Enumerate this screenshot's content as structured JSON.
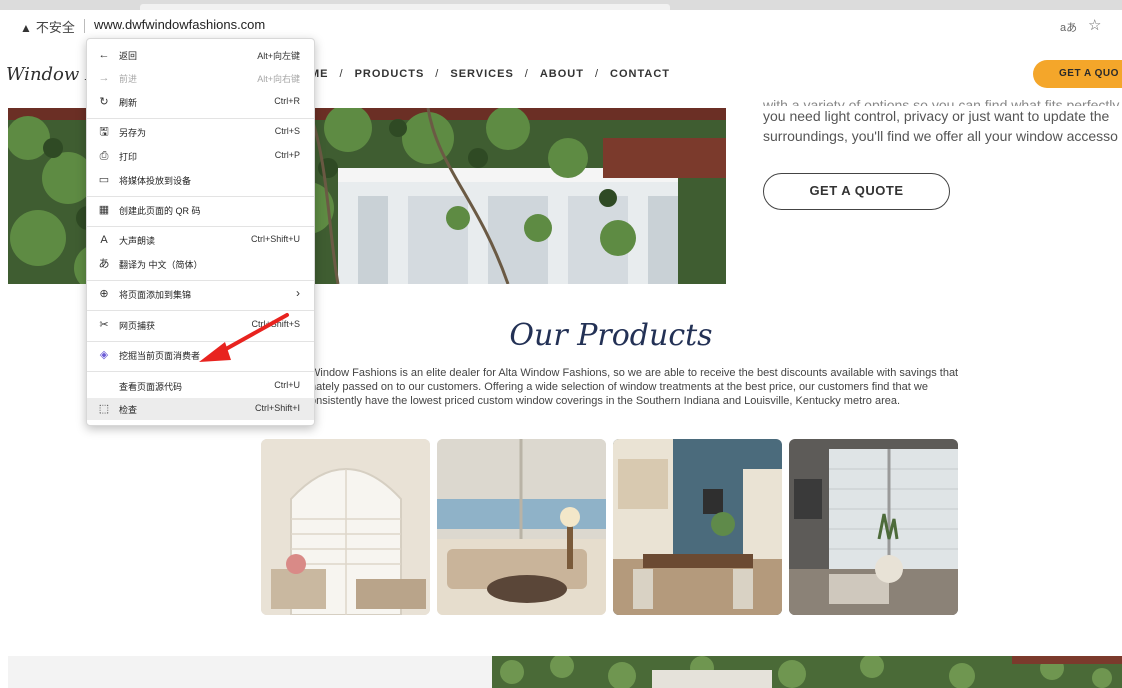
{
  "browser": {
    "security_label": "不安全",
    "url": "www.dwfwindowfashions.com",
    "translate_icon": "aあ",
    "favorites_icon": "star-plus"
  },
  "site": {
    "logo": "Window Fashions",
    "nav": [
      "ME",
      "PRODUCTS",
      "SERVICES",
      "ABOUT",
      "CONTACT"
    ],
    "nav_separator": "/",
    "header_cta": "GET A QUO",
    "hero": {
      "text_lines": [
        "with a variety of options so you can find what fits perfectly",
        "you need light control, privacy or just want to update the",
        "surroundings, you'll find we offer all your window accesso"
      ],
      "cta": "GET A QUOTE"
    },
    "products": {
      "title": "Our Products",
      "description": "Window Fashions is an elite dealer for Alta Window Fashions, so we are able to receive the best discounts available with savings that nately passed on to our customers. Offering a wide selection of window treatments at the best price, our customers find that we onsistently have the lowest priced custom window coverings in the Southern Indiana and Louisville, Kentucky metro area."
    }
  },
  "context_menu": {
    "items": [
      {
        "icon": "←",
        "label": "返回",
        "shortcut": "Alt+向左键",
        "disabled": false
      },
      {
        "icon": "→",
        "label": "前进",
        "shortcut": "Alt+向右键",
        "disabled": true
      },
      {
        "icon": "↻",
        "label": "刷新",
        "shortcut": "Ctrl+R",
        "disabled": false
      },
      {
        "icon": "🖫",
        "label": "另存为",
        "shortcut": "Ctrl+S",
        "disabled": false
      },
      {
        "icon": "⎙",
        "label": "打印",
        "shortcut": "Ctrl+P",
        "disabled": false
      },
      {
        "icon": "▭",
        "label": "将媒体投放到设备",
        "shortcut": "",
        "disabled": false
      },
      {
        "icon": "▦",
        "label": "创建此页面的 QR 码",
        "shortcut": "",
        "disabled": false
      },
      {
        "icon": "A",
        "label": "大声朗读",
        "shortcut": "Ctrl+Shift+U",
        "disabled": false
      },
      {
        "icon": "あ",
        "label": "翻译为 中文（简体）",
        "shortcut": "",
        "disabled": false
      },
      {
        "icon": "⊕",
        "label": "将页面添加到集锦",
        "shortcut": "›",
        "disabled": false
      },
      {
        "icon": "✂",
        "label": "网页捕获",
        "shortcut": "Ctrl+Shift+S",
        "disabled": false
      },
      {
        "icon": "◈",
        "label": "挖掘当前页面消费者",
        "shortcut": "",
        "disabled": false
      },
      {
        "icon": "",
        "label": "查看页面源代码",
        "shortcut": "Ctrl+U",
        "disabled": false
      },
      {
        "icon": "⬚",
        "label": "检查",
        "shortcut": "Ctrl+Shift+I",
        "disabled": false
      }
    ]
  },
  "colors": {
    "accent": "#f4a62a",
    "title_navy": "#233155",
    "annotation_red": "#e8231f"
  }
}
